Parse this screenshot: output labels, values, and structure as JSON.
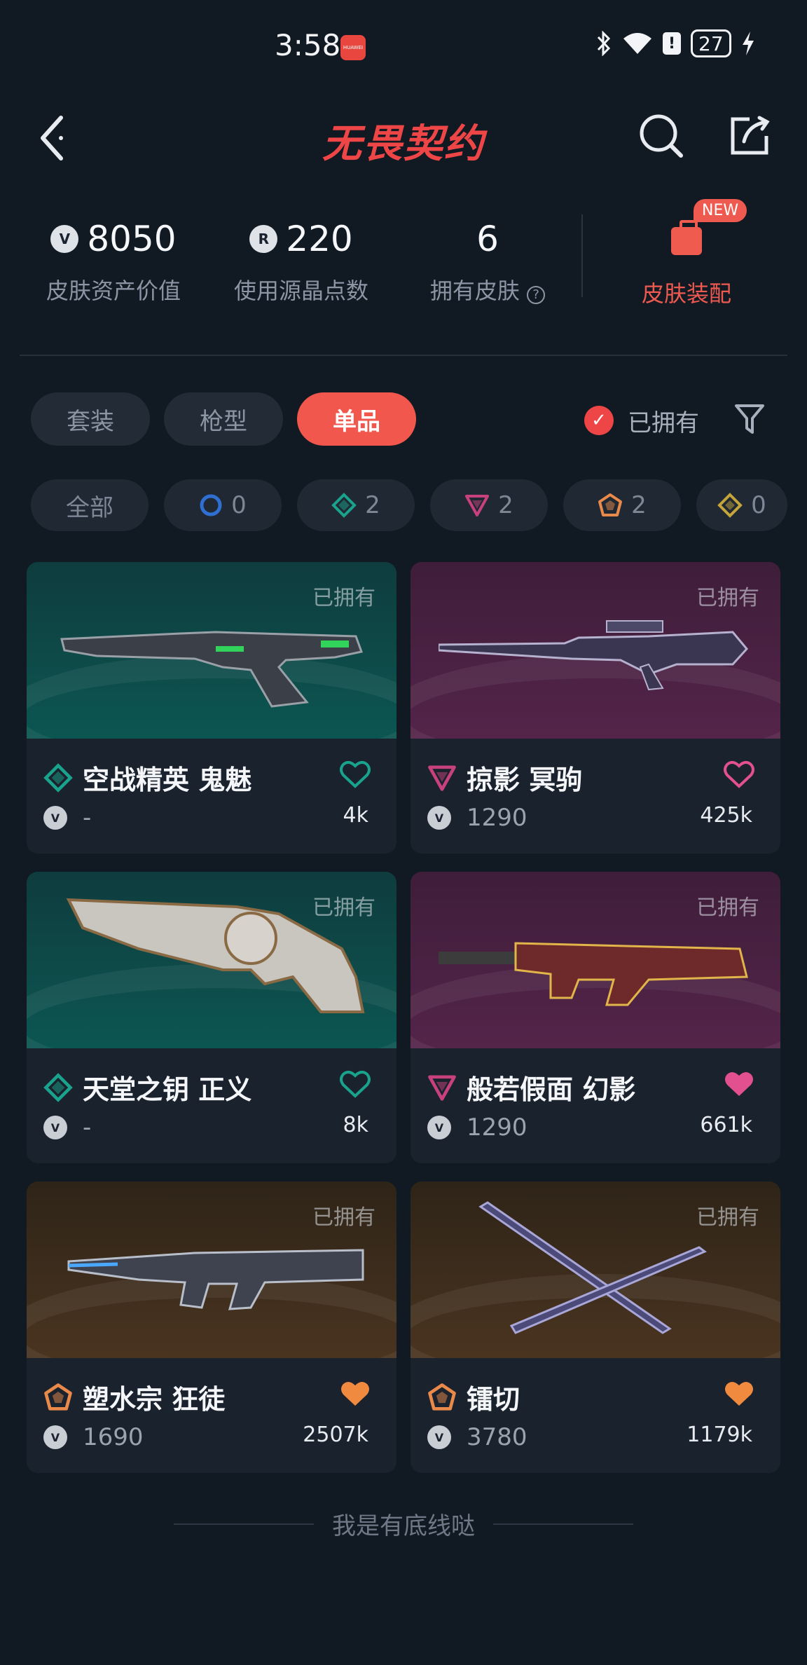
{
  "status_bar": {
    "time": "3:58",
    "battery": "27",
    "app_badge": "HUAWEI"
  },
  "header": {
    "title": "无畏契约"
  },
  "stats": {
    "asset_value": {
      "value": "8050",
      "label": "皮肤资产价值"
    },
    "radianite": {
      "value": "220",
      "label": "使用源晶点数"
    },
    "owned": {
      "value": "6",
      "label": "拥有皮肤"
    },
    "equip": {
      "label": "皮肤装配",
      "badge": "NEW"
    }
  },
  "tabs": [
    {
      "label": "套装",
      "active": false
    },
    {
      "label": "枪型",
      "active": false
    },
    {
      "label": "单品",
      "active": true
    }
  ],
  "owned_toggle": {
    "label": "已拥有",
    "checked": true
  },
  "rarity_chips": [
    {
      "label": "全部"
    },
    {
      "count": "0",
      "icon": "select-tier-icon",
      "color": "#2f6fd1"
    },
    {
      "count": "2",
      "icon": "deluxe-tier-icon",
      "color": "#1aa38c"
    },
    {
      "count": "2",
      "icon": "premium-tier-icon",
      "color": "#c7417e"
    },
    {
      "count": "2",
      "icon": "exclusive-tier-icon",
      "color": "#e9894a"
    },
    {
      "count": "0",
      "icon": "ultra-tier-icon",
      "color": "#c5a43a"
    }
  ],
  "cards": [
    {
      "name": "空战精英 鬼魅",
      "price": "-",
      "likes": "4k",
      "owned_tag": "已拥有",
      "tier": "deluxe",
      "liked": false
    },
    {
      "name": "掠影 冥驹",
      "price": "1290",
      "likes": "425k",
      "owned_tag": "已拥有",
      "tier": "premium",
      "liked": false
    },
    {
      "name": "天堂之钥 正义",
      "price": "-",
      "likes": "8k",
      "owned_tag": "已拥有",
      "tier": "deluxe",
      "liked": false
    },
    {
      "name": "般若假面 幻影",
      "price": "1290",
      "likes": "661k",
      "owned_tag": "已拥有",
      "tier": "premium",
      "liked": true
    },
    {
      "name": "塑水宗 狂徒",
      "price": "1690",
      "likes": "2507k",
      "owned_tag": "已拥有",
      "tier": "exclusive",
      "liked": true
    },
    {
      "name": "镭切",
      "price": "3780",
      "likes": "1179k",
      "owned_tag": "已拥有",
      "tier": "exclusive",
      "liked": true
    }
  ],
  "footer": {
    "text": "我是有底线哒"
  }
}
